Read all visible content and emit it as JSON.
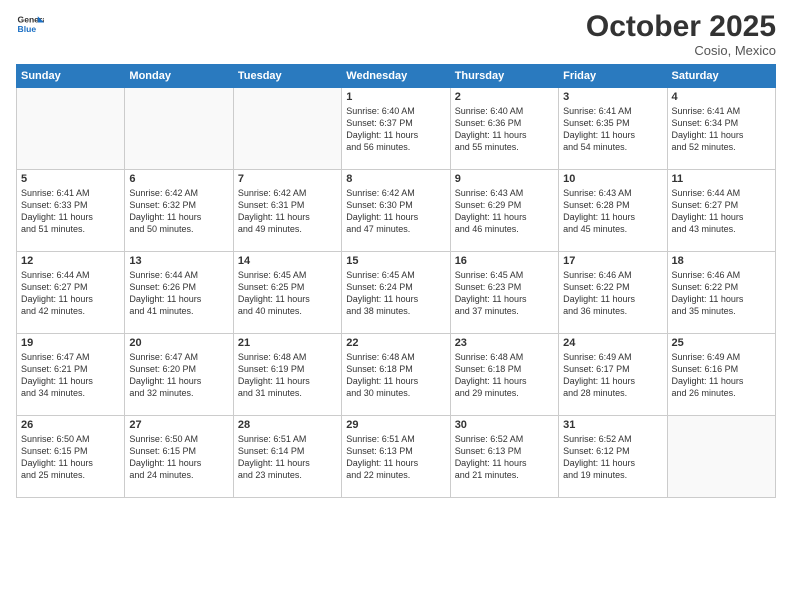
{
  "header": {
    "logo_line1": "General",
    "logo_line2": "Blue",
    "month": "October 2025",
    "location": "Cosio, Mexico"
  },
  "days_of_week": [
    "Sunday",
    "Monday",
    "Tuesday",
    "Wednesday",
    "Thursday",
    "Friday",
    "Saturday"
  ],
  "weeks": [
    [
      {
        "day": "",
        "info": ""
      },
      {
        "day": "",
        "info": ""
      },
      {
        "day": "",
        "info": ""
      },
      {
        "day": "1",
        "info": "Sunrise: 6:40 AM\nSunset: 6:37 PM\nDaylight: 11 hours\nand 56 minutes."
      },
      {
        "day": "2",
        "info": "Sunrise: 6:40 AM\nSunset: 6:36 PM\nDaylight: 11 hours\nand 55 minutes."
      },
      {
        "day": "3",
        "info": "Sunrise: 6:41 AM\nSunset: 6:35 PM\nDaylight: 11 hours\nand 54 minutes."
      },
      {
        "day": "4",
        "info": "Sunrise: 6:41 AM\nSunset: 6:34 PM\nDaylight: 11 hours\nand 52 minutes."
      }
    ],
    [
      {
        "day": "5",
        "info": "Sunrise: 6:41 AM\nSunset: 6:33 PM\nDaylight: 11 hours\nand 51 minutes."
      },
      {
        "day": "6",
        "info": "Sunrise: 6:42 AM\nSunset: 6:32 PM\nDaylight: 11 hours\nand 50 minutes."
      },
      {
        "day": "7",
        "info": "Sunrise: 6:42 AM\nSunset: 6:31 PM\nDaylight: 11 hours\nand 49 minutes."
      },
      {
        "day": "8",
        "info": "Sunrise: 6:42 AM\nSunset: 6:30 PM\nDaylight: 11 hours\nand 47 minutes."
      },
      {
        "day": "9",
        "info": "Sunrise: 6:43 AM\nSunset: 6:29 PM\nDaylight: 11 hours\nand 46 minutes."
      },
      {
        "day": "10",
        "info": "Sunrise: 6:43 AM\nSunset: 6:28 PM\nDaylight: 11 hours\nand 45 minutes."
      },
      {
        "day": "11",
        "info": "Sunrise: 6:44 AM\nSunset: 6:27 PM\nDaylight: 11 hours\nand 43 minutes."
      }
    ],
    [
      {
        "day": "12",
        "info": "Sunrise: 6:44 AM\nSunset: 6:27 PM\nDaylight: 11 hours\nand 42 minutes."
      },
      {
        "day": "13",
        "info": "Sunrise: 6:44 AM\nSunset: 6:26 PM\nDaylight: 11 hours\nand 41 minutes."
      },
      {
        "day": "14",
        "info": "Sunrise: 6:45 AM\nSunset: 6:25 PM\nDaylight: 11 hours\nand 40 minutes."
      },
      {
        "day": "15",
        "info": "Sunrise: 6:45 AM\nSunset: 6:24 PM\nDaylight: 11 hours\nand 38 minutes."
      },
      {
        "day": "16",
        "info": "Sunrise: 6:45 AM\nSunset: 6:23 PM\nDaylight: 11 hours\nand 37 minutes."
      },
      {
        "day": "17",
        "info": "Sunrise: 6:46 AM\nSunset: 6:22 PM\nDaylight: 11 hours\nand 36 minutes."
      },
      {
        "day": "18",
        "info": "Sunrise: 6:46 AM\nSunset: 6:22 PM\nDaylight: 11 hours\nand 35 minutes."
      }
    ],
    [
      {
        "day": "19",
        "info": "Sunrise: 6:47 AM\nSunset: 6:21 PM\nDaylight: 11 hours\nand 34 minutes."
      },
      {
        "day": "20",
        "info": "Sunrise: 6:47 AM\nSunset: 6:20 PM\nDaylight: 11 hours\nand 32 minutes."
      },
      {
        "day": "21",
        "info": "Sunrise: 6:48 AM\nSunset: 6:19 PM\nDaylight: 11 hours\nand 31 minutes."
      },
      {
        "day": "22",
        "info": "Sunrise: 6:48 AM\nSunset: 6:18 PM\nDaylight: 11 hours\nand 30 minutes."
      },
      {
        "day": "23",
        "info": "Sunrise: 6:48 AM\nSunset: 6:18 PM\nDaylight: 11 hours\nand 29 minutes."
      },
      {
        "day": "24",
        "info": "Sunrise: 6:49 AM\nSunset: 6:17 PM\nDaylight: 11 hours\nand 28 minutes."
      },
      {
        "day": "25",
        "info": "Sunrise: 6:49 AM\nSunset: 6:16 PM\nDaylight: 11 hours\nand 26 minutes."
      }
    ],
    [
      {
        "day": "26",
        "info": "Sunrise: 6:50 AM\nSunset: 6:15 PM\nDaylight: 11 hours\nand 25 minutes."
      },
      {
        "day": "27",
        "info": "Sunrise: 6:50 AM\nSunset: 6:15 PM\nDaylight: 11 hours\nand 24 minutes."
      },
      {
        "day": "28",
        "info": "Sunrise: 6:51 AM\nSunset: 6:14 PM\nDaylight: 11 hours\nand 23 minutes."
      },
      {
        "day": "29",
        "info": "Sunrise: 6:51 AM\nSunset: 6:13 PM\nDaylight: 11 hours\nand 22 minutes."
      },
      {
        "day": "30",
        "info": "Sunrise: 6:52 AM\nSunset: 6:13 PM\nDaylight: 11 hours\nand 21 minutes."
      },
      {
        "day": "31",
        "info": "Sunrise: 6:52 AM\nSunset: 6:12 PM\nDaylight: 11 hours\nand 19 minutes."
      },
      {
        "day": "",
        "info": ""
      }
    ]
  ]
}
